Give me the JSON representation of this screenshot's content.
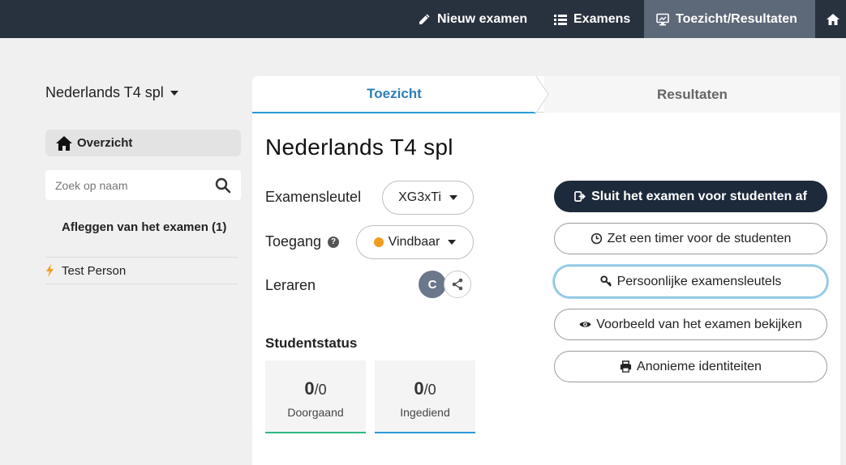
{
  "nav": {
    "new_exam": "Nieuw examen",
    "exams": "Examens",
    "monitor_results": "Toezicht/Resultaten",
    "icons": [
      "pencil-icon",
      "list-icon",
      "monitor-icon",
      "home-icon"
    ]
  },
  "sidebar": {
    "exam_name": "Nederlands T4 spl",
    "overview_label": "Overzicht",
    "search_placeholder": "Zoek op naam",
    "group_title": "Afleggen van het examen (1)",
    "students": [
      {
        "name": "Test Person",
        "status_icon": "bolt-icon",
        "status_color": "#f39c1f"
      }
    ]
  },
  "tabs": {
    "monitor": "Toezicht",
    "results": "Resultaten"
  },
  "main": {
    "title": "Nederlands T4 spl",
    "exam_key_label": "Examensleutel",
    "exam_key_value": "XG3xTi",
    "access_label": "Toegang",
    "access_help": "?",
    "access_value": "Vindbaar",
    "access_color": "#f39c1f",
    "teachers_label": "Leraren",
    "teacher_initial": "C",
    "status_title": "Studentstatus",
    "ongoing": {
      "count": "0",
      "total": "/0",
      "label": "Doorgaand"
    },
    "submitted": {
      "count": "0",
      "total": "/0",
      "label": "Ingediend"
    }
  },
  "actions": {
    "close_exam": "Sluit het examen voor studenten af",
    "set_timer": "Zet een timer voor de studenten",
    "personal_keys": "Persoonlijke examensleutels",
    "preview": "Voorbeeld van het examen bekijken",
    "anonymous": "Anonieme identiteiten"
  },
  "colors": {
    "nav_bg": "#28323f",
    "nav_active": "#5d6878",
    "primary_btn": "#1c2a3b",
    "tab_active": "#2b7fb6",
    "ongoing_accent": "#2eb883",
    "submitted_accent": "#2b9ad8"
  }
}
